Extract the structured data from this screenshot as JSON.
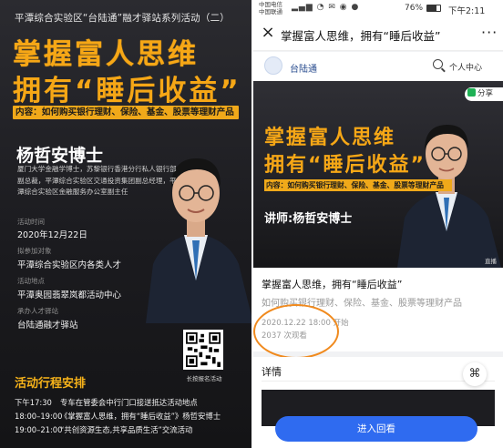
{
  "poster": {
    "top_line": "平潭综合实验区“台陆通”融才驿站系列活动（二）",
    "headline1": "掌握富人思维",
    "headline2": "拥有“睡后收益”",
    "content_bar": "内容：如何购买银行理财、保险、基金、股票等理财产品",
    "speaker_name": "杨哲安博士",
    "bio": "厦门大学金融学博士，苏黎银行香港分行私人银行部副总裁，平潭综合实验区交通投资集团副总经理，平潭综合实验区金融服务办公室副主任",
    "time_label": "活动时间",
    "time_value": "2020年12月22日",
    "target_label": "拟参加对象",
    "target_value": "平潭综合实验区内各类人才",
    "location_label": "活动地点",
    "location_value": "平潭奥园翡翠岚都活动中心",
    "host_label": "承办人才驿站",
    "host_value": "台陆通融才驿站",
    "schedule_title": "活动行程安排",
    "schedule": [
      {
        "time": "下午17:30",
        "text": "专车在管委会中行门口接送抵达活动地点"
      },
      {
        "time": "18:00–19:00",
        "text": "《掌握富人思维，拥有“睡后收益”》杨哲安博士"
      },
      {
        "time": "19:00–21:00",
        "text": "“共创资源生态,共享品质生活”交流活动"
      }
    ],
    "qr_caption": "长按报名活动"
  },
  "phone": {
    "status_left_top": "中国电信",
    "status_left_bottom": "中国联通",
    "status_right": "76%",
    "clock": "下午2:11",
    "nav_title": "掌握富人思维，拥有“睡后收益”",
    "more_label": "···",
    "close_label": "×",
    "app_name": "台陆通",
    "user_center": "个人中心",
    "share_label": "分享",
    "video_headline1": "掌握富人思维",
    "video_headline2": "拥有“睡后收益”",
    "video_content_bar": "内容：如何购买银行理财、保险、基金、股票等理财产品",
    "video_lecturer": "讲师:杨哲安博士",
    "live_tag": "直播",
    "course_title": "掌握富人思维，拥有“睡后收益”",
    "course_desc": "如何购买银行理财、保险、基金、股票等理财产品",
    "course_date": "2020.12.22 18:00 开始",
    "course_views": "2037 次观看",
    "detail_title": "详情",
    "grid_icon_label": "⌘",
    "enter_button": "进入回看"
  },
  "colors": {
    "gold": "#f6a716",
    "primary_blue": "#2f6bf0",
    "highlight_circle": "#f08a1e"
  }
}
